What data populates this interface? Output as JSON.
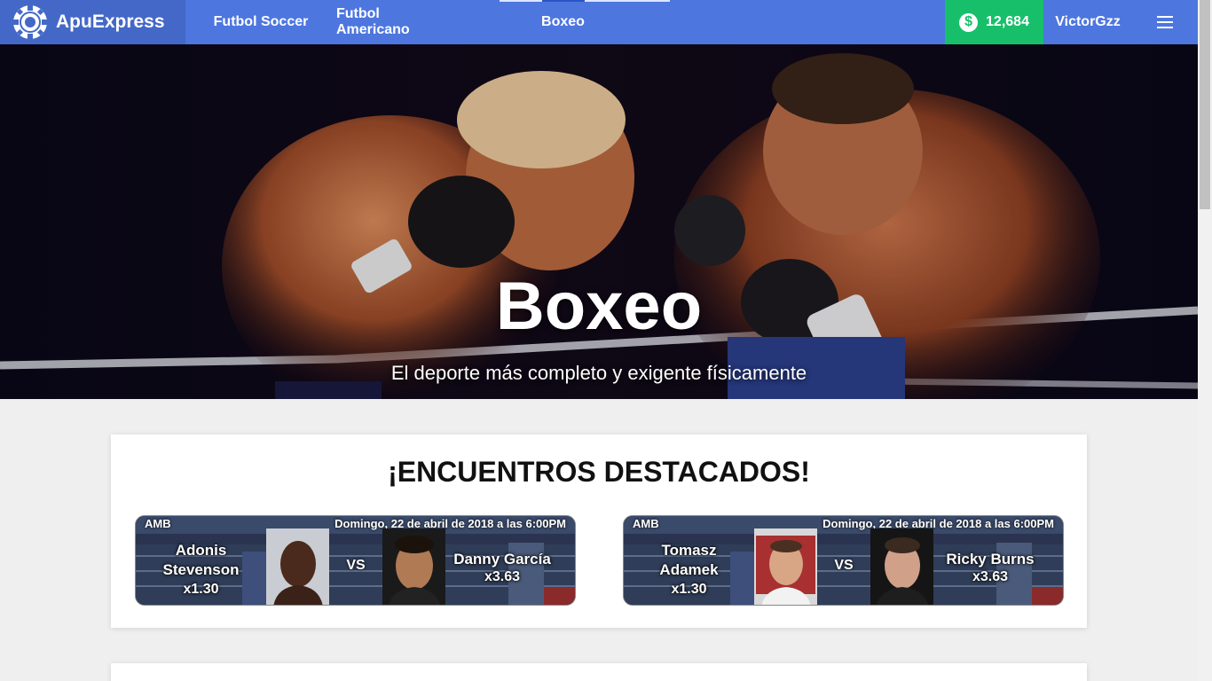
{
  "app": {
    "name": "ApuExpress",
    "logo_icon": "poker-chip-icon"
  },
  "nav": {
    "links": [
      {
        "label": "Futbol Soccer"
      },
      {
        "label": "Futbol Americano"
      },
      {
        "label": "Boxeo"
      }
    ],
    "active": "Boxeo"
  },
  "account": {
    "balance": "12,684",
    "balance_icon": "dollar-icon",
    "username": "VictorGzz",
    "menu_icon": "hamburger-menu-icon"
  },
  "hero": {
    "title": "Boxeo",
    "subtitle": "El deporte más completo y exigente físicamente"
  },
  "featured": {
    "heading": "¡ENCUENTROS DESTACADOS!",
    "vs_label": "VS",
    "matches": [
      {
        "org": "AMB",
        "date": "Domingo, 22 de abril de 2018 a las 6:00PM",
        "left": {
          "name_line1": "Adonis",
          "name_line2": "Stevenson",
          "odds": "x1.30"
        },
        "right": {
          "name": "Danny García",
          "odds": "x3.63"
        }
      },
      {
        "org": "AMB",
        "date": "Domingo, 22 de abril de 2018 a las 6:00PM",
        "left": {
          "name_line1": "Tomasz",
          "name_line2": "Adamek",
          "odds": "x1.30"
        },
        "right": {
          "name": "Ricky Burns",
          "odds": "x3.63"
        }
      }
    ]
  },
  "colors": {
    "navbar": "#4d76df",
    "brand_bg": "#4468c8",
    "balance_bg": "#17bf6b"
  }
}
